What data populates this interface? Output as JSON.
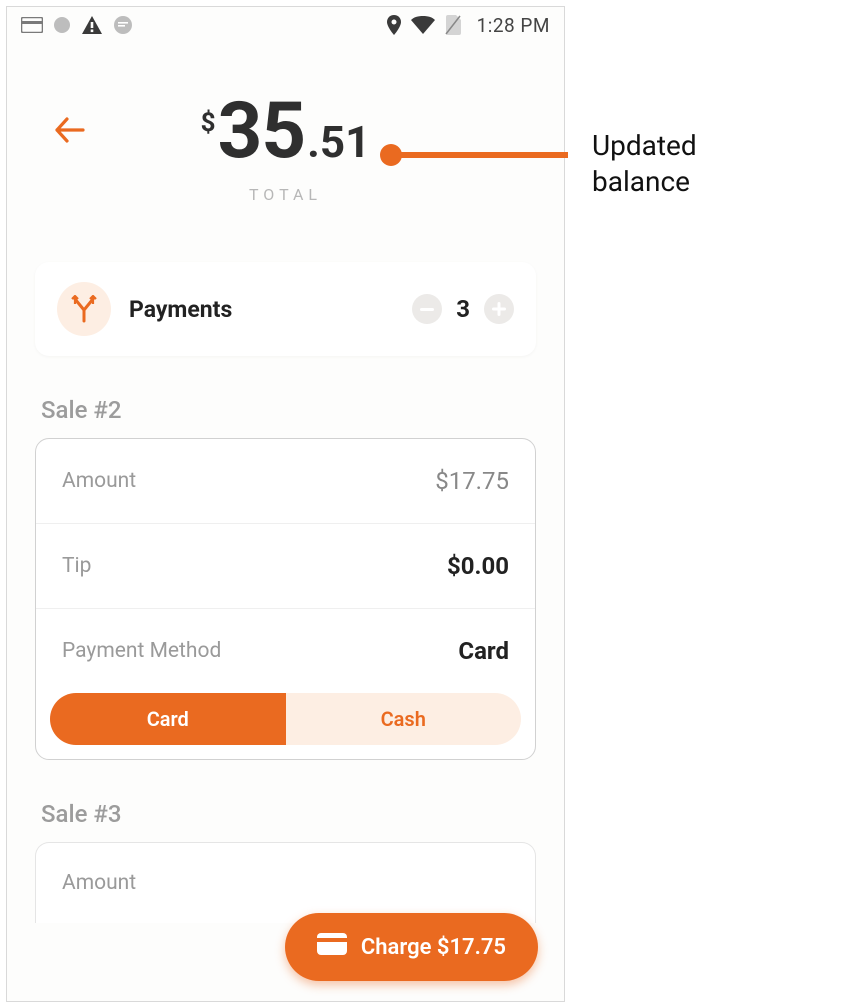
{
  "status": {
    "time": "1:28 PM"
  },
  "header": {
    "currency": "$",
    "whole": "35",
    "cents": ".51",
    "total_label": "TOTAL"
  },
  "payments": {
    "label": "Payments",
    "count": "3"
  },
  "sale2": {
    "title": "Sale #2",
    "amount_label": "Amount",
    "amount_value": "$17.75",
    "tip_label": "Tip",
    "tip_value": "$0.00",
    "method_label": "Payment Method",
    "method_value": "Card",
    "seg_card": "Card",
    "seg_cash": "Cash"
  },
  "sale3": {
    "title": "Sale #3",
    "amount_label": "Amount"
  },
  "fab": {
    "label": "Charge $17.75"
  },
  "annotation": {
    "text": "Updated balance"
  }
}
